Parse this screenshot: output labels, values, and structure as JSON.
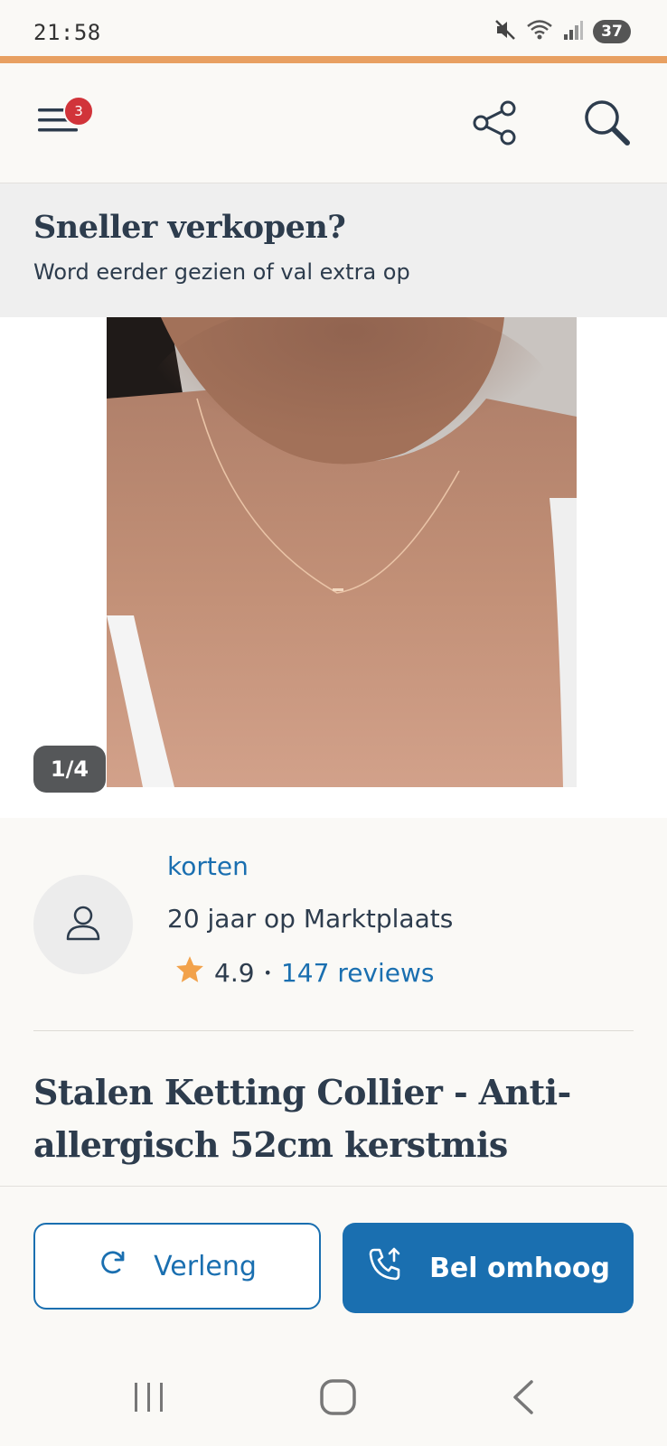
{
  "status_bar": {
    "time": "21:58",
    "battery": "37",
    "icons": [
      "mute-icon",
      "wifi-icon",
      "signal-icon"
    ]
  },
  "app_bar": {
    "menu_badge": "3",
    "icons": [
      "hamburger-menu-icon",
      "share-icon",
      "search-icon"
    ]
  },
  "promo": {
    "title": "Sneller verkopen?",
    "chevron": "›",
    "subtitle": "Word eerder gezien of val extra op"
  },
  "gallery": {
    "counter": "1/4"
  },
  "seller": {
    "name": "korten",
    "since": "20 jaar op Marktplaats",
    "rating": "4.9",
    "separator": "•",
    "reviews": "147 reviews"
  },
  "listing": {
    "title": "Stalen Ketting Collier - Anti-allergisch 52cm kerstmis"
  },
  "actions": {
    "extend_label": "Verleng",
    "bump_label": "Bel omhoog"
  },
  "colors": {
    "accent_orange": "#e8a062",
    "brand_blue": "#1a6fb0",
    "text_dark": "#2d3c4d",
    "badge_red": "#d1343a",
    "star": "#f2a24b"
  }
}
